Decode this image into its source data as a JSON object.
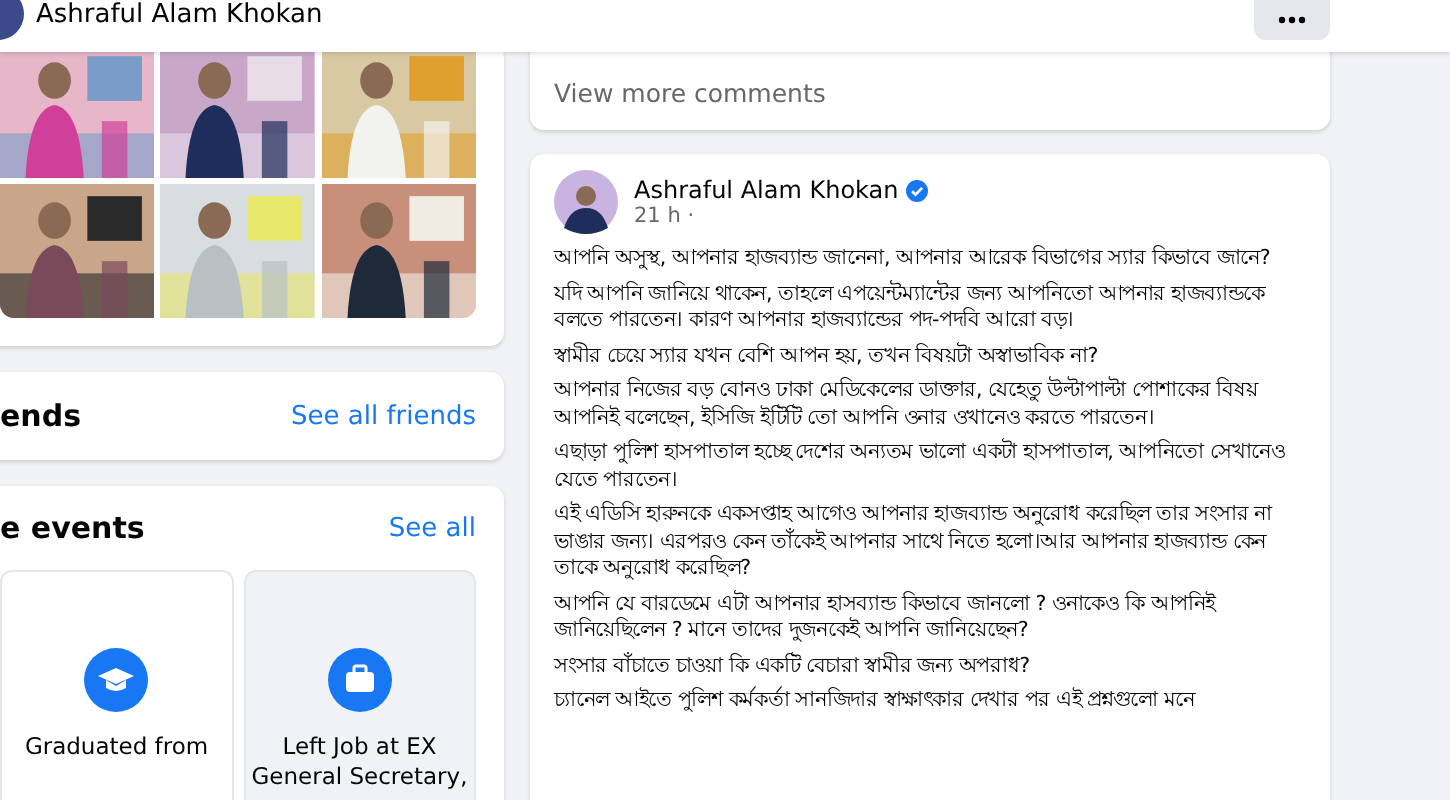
{
  "header": {
    "name": "Ashraful Alam Khokan"
  },
  "friends": {
    "title": "ends",
    "link": "See all friends"
  },
  "events": {
    "title": "e events",
    "link": "See all",
    "items": [
      {
        "kind": "graduation",
        "lines": [
          "Graduated from"
        ]
      },
      {
        "kind": "job",
        "lines": [
          "Left Job at EX",
          "General Secretary,"
        ]
      }
    ]
  },
  "comments": {
    "link": "View more comments"
  },
  "post": {
    "author": "Ashraful Alam Khokan",
    "verified": true,
    "time": "21 h ·",
    "paragraphs": [
      "আপনি অসুস্থ, আপনার হাজব্যান্ড জানেনা, আপনার আরেক বিভাগের স্যার কিভাবে জানে?",
      "যদি আপনি জানিয়ে থাকেন, তাহলে এপয়েন্টম্যান্টের জন্য আপনিতো আপনার হাজব্যান্ডকে বলতে পারতেন।  কারণ আপনার হাজব্যান্ডের পদ-পদবি আরো বড়।",
      "স্বামীর চেয়ে স্যার যখন বেশি আপন হয়, তখন বিষয়টা অস্বাভাবিক না?",
      "আপনার নিজের বড় বোনও ঢাকা মেডিকেলের ডাক্তার, যেহেতু উল্টাপাল্টা পোশাকের বিষয় আপনিই বলেছেন, ইসিজি ইটিটি তো আপনি ওনার ওখানেও করতে পারতেন।",
      "এছাড়া পুলিশ হাসপাতাল হচ্ছে দেশের অন্যতম ভালো একটা হাসপাতাল, আপনিতো সেখানেও যেতে পারতেন।",
      "এই এডিসি হারুনকে একসপ্তাহ আগেও আপনার হাজব্যান্ড অনুরোধ করেছিল তার সংসার না ভাঙার জন্য। এরপরও কেন তাঁকেই আপনার সাথে নিতে হলো।আর আপনার হাজব্যান্ড কেন তাকে অনুরোধ করেছিল?",
      "আপনি যে বারডেমে এটা আপনার হাসব্যান্ড কিভাবে জানলো ? ওনাকেও কি আপনিই জানিয়েছিলেন ? মানে তাদের দুজনকেই আপনি জানিয়েছেন?",
      "সংসার বাঁচাতে চাওয়া কি একটি বেচারা স্বামীর জন্য  অপরাধ?",
      "চ্যানেল আইতে পুলিশ কর্মকর্তা সানজিদার স্বাক্ষাৎকার দেখার পর এই প্রশ্নগুলো মনে"
    ]
  }
}
